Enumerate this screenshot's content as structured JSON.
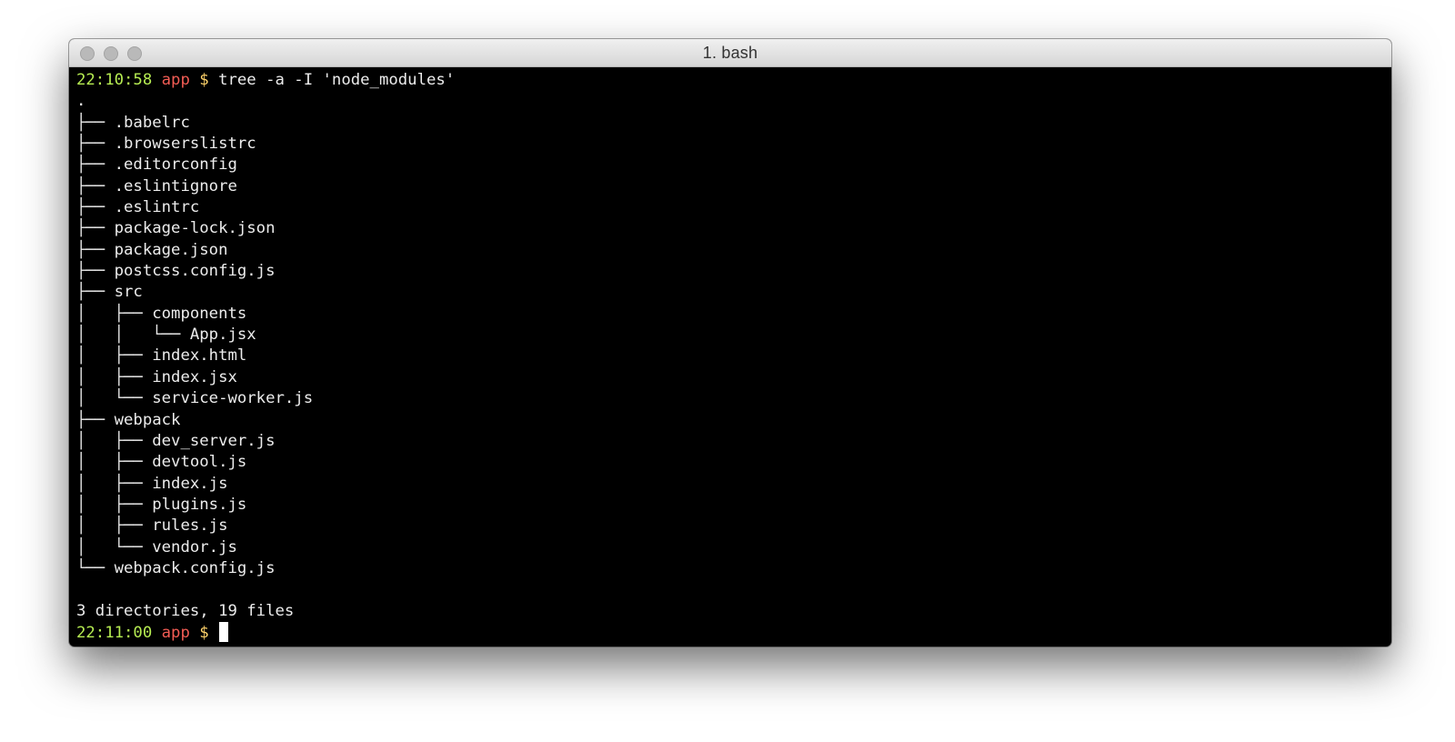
{
  "window": {
    "title": "1. bash"
  },
  "prompt1": {
    "time": "22:10:58",
    "host": "app",
    "symbol": "$",
    "command": "tree -a -I 'node_modules'"
  },
  "tree_lines": [
    ".",
    "├── .babelrc",
    "├── .browserslistrc",
    "├── .editorconfig",
    "├── .eslintignore",
    "├── .eslintrc",
    "├── package-lock.json",
    "├── package.json",
    "├── postcss.config.js",
    "├── src",
    "│   ├── components",
    "│   │   └── App.jsx",
    "│   ├── index.html",
    "│   ├── index.jsx",
    "│   └── service-worker.js",
    "├── webpack",
    "│   ├── dev_server.js",
    "│   ├── devtool.js",
    "│   ├── index.js",
    "│   ├── plugins.js",
    "│   ├── rules.js",
    "│   └── vendor.js",
    "└── webpack.config.js"
  ],
  "summary": "3 directories, 19 files",
  "prompt2": {
    "time": "22:11:00",
    "host": "app",
    "symbol": "$"
  },
  "colors": {
    "time": "#b6ec52",
    "host": "#f25c54",
    "dollar": "#ffd36a",
    "text": "#ececec",
    "background": "#000000"
  }
}
